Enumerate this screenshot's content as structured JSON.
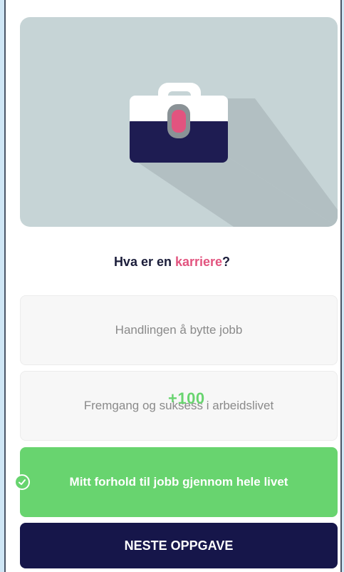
{
  "question": {
    "prefix": "Hva er en ",
    "highlight": "karriere",
    "suffix": "?"
  },
  "options": [
    {
      "label": "Handlingen å bytte jobb",
      "state": "default"
    },
    {
      "label": "Fremgang og suksess i arbeidslivet",
      "state": "default"
    },
    {
      "label": "Mitt forhold til jobb gjennom hele livet",
      "state": "correct"
    }
  ],
  "points_awarded": "+100",
  "next_button": {
    "label": "NESTE OPPGAVE"
  },
  "illustration": {
    "icon": "briefcase-icon"
  },
  "colors": {
    "highlight": "#e2547f",
    "correct": "#68d46f",
    "primary": "#16164a",
    "illustration_bg": "#c6d4d6"
  }
}
